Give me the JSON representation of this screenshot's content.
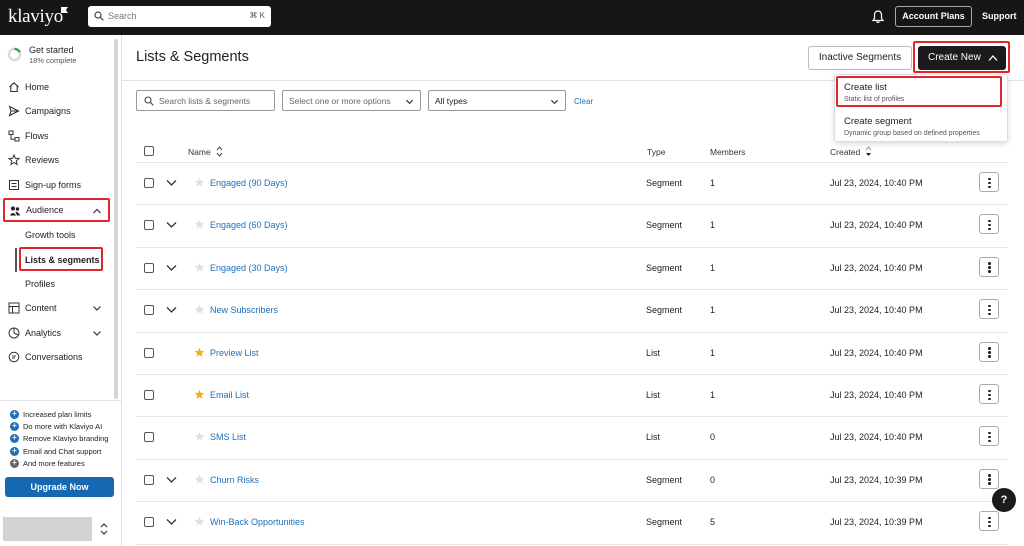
{
  "topbar": {
    "logo": "klaviyo",
    "search_placeholder": "Search",
    "search_shortcut": "⌘ K",
    "account_plans": "Account Plans",
    "support": "Support"
  },
  "sidebar": {
    "get_started": {
      "title": "Get started",
      "progress": "18% complete"
    },
    "nav": [
      {
        "label": "Home",
        "icon": "home-icon"
      },
      {
        "label": "Campaigns",
        "icon": "send-icon"
      },
      {
        "label": "Flows",
        "icon": "flows-icon"
      },
      {
        "label": "Reviews",
        "icon": "star-icon"
      },
      {
        "label": "Sign-up forms",
        "icon": "form-icon"
      },
      {
        "label": "Audience",
        "icon": "people-icon"
      },
      {
        "label": "Content",
        "icon": "content-icon"
      },
      {
        "label": "Analytics",
        "icon": "analytics-icon"
      },
      {
        "label": "Conversations",
        "icon": "chat-icon"
      }
    ],
    "audience_sub": [
      "Growth tools",
      "Lists & segments",
      "Profiles"
    ],
    "features": [
      "Increased plan limits",
      "Do more with Klaviyo AI",
      "Remove Klaviyo branding",
      "Email and Chat support",
      "And more features"
    ],
    "upgrade": "Upgrade Now"
  },
  "main": {
    "title": "Lists & Segments",
    "inactive_segments": "Inactive Segments",
    "create_new": "Create New",
    "filters": {
      "search_placeholder": "Search lists & segments",
      "options_placeholder": "Select one or more options",
      "type_value": "All types",
      "clear": "Clear"
    },
    "menu": [
      {
        "title": "Create list",
        "subtitle": "Static list of profiles"
      },
      {
        "title": "Create segment",
        "subtitle": "Dynamic group based on defined properties"
      }
    ],
    "table": {
      "headers": {
        "name": "Name",
        "type": "Type",
        "members": "Members",
        "created": "Created"
      },
      "rows": [
        {
          "name": "Engaged (90 Days)",
          "type": "Segment",
          "members": "1",
          "created": "Jul 23, 2024, 10:40 PM",
          "starred": false,
          "expandable": true
        },
        {
          "name": "Engaged (60 Days)",
          "type": "Segment",
          "members": "1",
          "created": "Jul 23, 2024, 10:40 PM",
          "starred": false,
          "expandable": true
        },
        {
          "name": "Engaged (30 Days)",
          "type": "Segment",
          "members": "1",
          "created": "Jul 23, 2024, 10:40 PM",
          "starred": false,
          "expandable": true
        },
        {
          "name": "New Subscribers",
          "type": "Segment",
          "members": "1",
          "created": "Jul 23, 2024, 10:40 PM",
          "starred": false,
          "expandable": true
        },
        {
          "name": "Preview List",
          "type": "List",
          "members": "1",
          "created": "Jul 23, 2024, 10:40 PM",
          "starred": true,
          "expandable": false
        },
        {
          "name": "Email List",
          "type": "List",
          "members": "1",
          "created": "Jul 23, 2024, 10:40 PM",
          "starred": true,
          "expandable": false
        },
        {
          "name": "SMS List",
          "type": "List",
          "members": "0",
          "created": "Jul 23, 2024, 10:40 PM",
          "starred": false,
          "expandable": false
        },
        {
          "name": "Churn Risks",
          "type": "Segment",
          "members": "0",
          "created": "Jul 23, 2024, 10:39 PM",
          "starred": false,
          "expandable": true
        },
        {
          "name": "Win-Back Opportunities",
          "type": "Segment",
          "members": "5",
          "created": "Jul 23, 2024, 10:39 PM",
          "starred": false,
          "expandable": true
        }
      ]
    },
    "help": "?"
  },
  "colors": {
    "topbar_bg": "#161616",
    "link": "#1f6fb8",
    "highlight": "#e0262a",
    "upgrade_bg": "#1569b3",
    "star_filled": "#f2b01e"
  }
}
